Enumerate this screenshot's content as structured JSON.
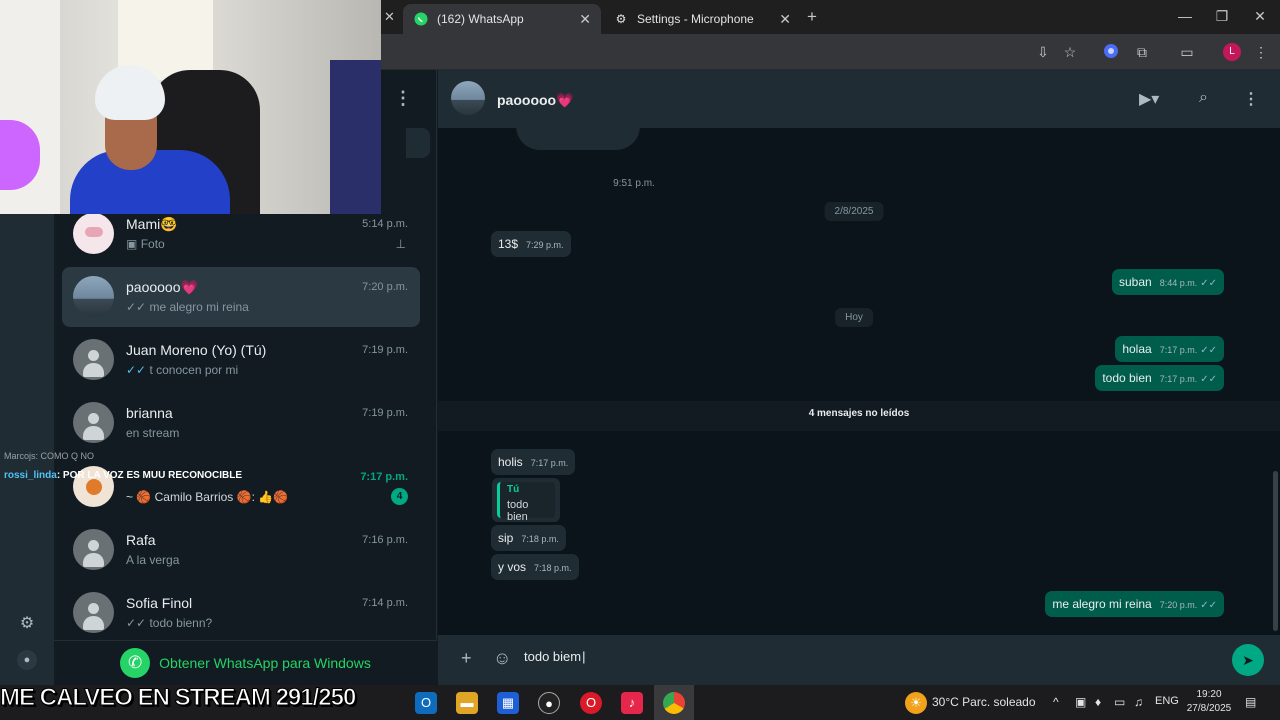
{
  "browser": {
    "tabs": [
      {
        "label": "(162) WhatsApp",
        "active": true
      },
      {
        "label": "Settings - Microphone",
        "active": false
      }
    ],
    "new_tab": "+",
    "profile_initial": "L"
  },
  "sidebar": {
    "chats": [
      {
        "name": "Mami🤓",
        "time": "5:14 p.m.",
        "preview": "Foto",
        "pinned": true
      },
      {
        "name": "paooooo💗",
        "time": "7:20 p.m.",
        "preview": "me alegro mi reina",
        "active": true
      },
      {
        "name": "Juan Moreno (Yo) (Tú)",
        "time": "7:19 p.m.",
        "preview": "t conocen por mi"
      },
      {
        "name": "brianna",
        "time": "7:19 p.m.",
        "preview": "en stream"
      },
      {
        "name": "",
        "time": "7:17 p.m.",
        "preview": "~ 🏀 Camilo Barrios 🏀: 👍🏀",
        "unread": "4"
      },
      {
        "name": "Rafa",
        "time": "7:16 p.m.",
        "preview": "A la verga"
      },
      {
        "name": "Sofia Finol",
        "time": "7:14 p.m.",
        "preview": "todo bienn?"
      }
    ],
    "get_app": "Obtener WhatsApp para Windows"
  },
  "conversation": {
    "contact_name": "paooooo💗",
    "date_chips": {
      "first_time": "9:51 p.m.",
      "date1": "2/8/2025",
      "today": "Hoy"
    },
    "messages": {
      "m1": {
        "text": "13$",
        "time": "7:29 p.m."
      },
      "m2": {
        "text": "suban",
        "time": "8:44 p.m."
      },
      "m3": {
        "text": "holaa",
        "time": "7:17 p.m."
      },
      "m4": {
        "text": "todo bien",
        "time": "7:17 p.m."
      },
      "m5": {
        "text": "holis",
        "time": "7:17 p.m."
      },
      "m6": {
        "text": "sip",
        "time": "7:18 p.m."
      },
      "m7": {
        "text": "y vos",
        "time": "7:18 p.m."
      },
      "m8": {
        "text": "me alegro mi reina",
        "time": "7:20 p.m."
      }
    },
    "quote": {
      "author": "Tú",
      "text": "todo bien"
    },
    "unread_label": "4 mensajes no leídos",
    "composer_value": "todo biem"
  },
  "stream_overlay": {
    "chat_line1_user": "Marcojs",
    "chat_line1_text": ": COMO Q NO",
    "chat_line2_user": "rossi_linda",
    "chat_line2_text": ": POR LA VOZ ES MUU RECONOCIBLE",
    "goal": "ME CALVEO EN STREAM 291/250"
  },
  "taskbar": {
    "weather": "30°C  Parc. soleado",
    "lang": "ENG",
    "time": "19:20",
    "date": "27/8/2025"
  },
  "colors": {
    "accent": "#00a884",
    "outgoing": "#005c4b",
    "incoming": "#202c33"
  }
}
